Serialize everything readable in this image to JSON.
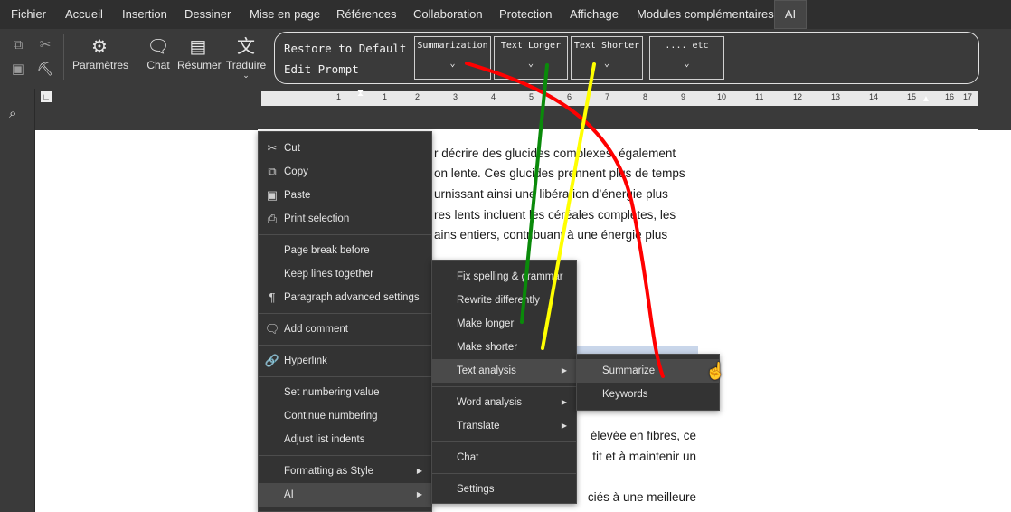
{
  "menubar": {
    "items": [
      "Fichier",
      "Accueil",
      "Insertion",
      "Dessiner",
      "Mise en page",
      "Références",
      "Collaboration",
      "Protection",
      "Affichage",
      "Modules complémentaires",
      "AI"
    ]
  },
  "toolbar": {
    "parametres": "Paramètres",
    "chat": "Chat",
    "resumer": "Résumer",
    "traduire": "Traduire",
    "ai_panel": {
      "restore_default": "Restore to Default",
      "edit_prompt": "Edit Prompt",
      "dropdowns": [
        "Summarization",
        "Text Longer",
        "Text Shorter",
        ".... etc"
      ]
    }
  },
  "ruler": {
    "numbers": [
      "1",
      "1",
      "2",
      "3",
      "4",
      "5",
      "6",
      "7",
      "8",
      "9",
      "10",
      "11",
      "12",
      "13",
      "14",
      "15",
      "16",
      "17"
    ]
  },
  "document": {
    "lines": [
      "r décrire des glucides complexes, également",
      "on lente. Ces glucides prennent plus de temps",
      "urnissant ainsi une libération d’énergie plus",
      "res lents incluent les céréales complètes, les",
      "ains entiers, contribuant à une énergie plus"
    ],
    "lines_lower": [
      "élevée en fibres, ce",
      "tit et à maintenir un"
    ],
    "partial_bottom": "ciés à une meilleure"
  },
  "context_menu": {
    "items": [
      {
        "label": "Cut",
        "icon": "cut-icon"
      },
      {
        "label": "Copy",
        "icon": "copy-icon"
      },
      {
        "label": "Paste",
        "icon": "paste-icon"
      },
      {
        "label": "Print selection",
        "icon": "print-icon"
      },
      {
        "label": "Page break before"
      },
      {
        "label": "Keep lines together"
      },
      {
        "label": "Paragraph advanced settings",
        "icon": "paragraph-icon"
      },
      {
        "label": "Add comment",
        "icon": "comment-icon"
      },
      {
        "label": "Hyperlink",
        "icon": "link-icon"
      },
      {
        "label": "Set numbering value"
      },
      {
        "label": "Continue numbering"
      },
      {
        "label": "Adjust list indents"
      },
      {
        "label": "Formatting as Style"
      },
      {
        "label": "AI"
      }
    ]
  },
  "ai_submenu": {
    "items": [
      "Fix spelling & grammar",
      "Rewrite differently",
      "Make longer",
      "Make shorter",
      "Text analysis",
      "Word analysis",
      "Translate",
      "Chat",
      "Settings"
    ]
  },
  "text_analysis_submenu": {
    "items": [
      "Summarize",
      "Keywords"
    ]
  },
  "annotations": {
    "colors": {
      "red": "#ff0000",
      "green": "#0a8a0a",
      "yellow": "#ffff00"
    }
  }
}
